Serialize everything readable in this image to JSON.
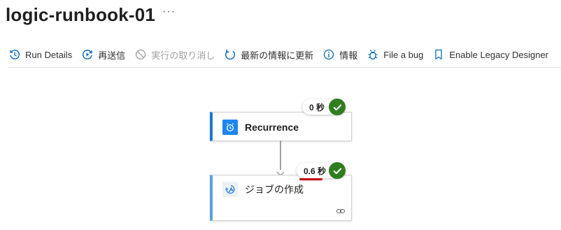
{
  "header": {
    "title": "logic-runbook-01",
    "more": "···"
  },
  "toolbar": {
    "items": [
      {
        "label": "Run Details",
        "icon": "history-icon",
        "enabled": true
      },
      {
        "label": "再送信",
        "icon": "resubmit-icon",
        "enabled": true
      },
      {
        "label": "実行の取り消し",
        "icon": "cancel-icon",
        "enabled": false
      },
      {
        "label": "最新の情報に更新",
        "icon": "refresh-icon",
        "enabled": true
      },
      {
        "label": "情報",
        "icon": "info-icon",
        "enabled": true
      },
      {
        "label": "File a bug",
        "icon": "bug-icon",
        "enabled": true
      },
      {
        "label": "Enable Legacy Designer",
        "icon": "bookmark-icon",
        "enabled": true
      }
    ]
  },
  "flow": {
    "steps": [
      {
        "label": "Recurrence",
        "duration": "0 秒",
        "status": "succeeded",
        "icon": "alarm-clock-icon",
        "accent": "#1f78d1"
      },
      {
        "label": "ジョブの作成",
        "duration": "0.6 秒",
        "status": "succeeded",
        "icon": "automation-icon",
        "accent": "#5aa2db"
      }
    ]
  },
  "colors": {
    "success": "#2f7d1f",
    "highlight": "#c00000",
    "primary": "#1e86f0"
  }
}
